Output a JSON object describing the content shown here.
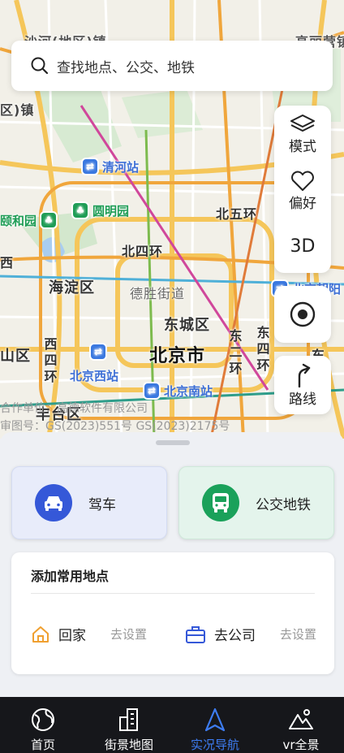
{
  "search": {
    "placeholder": "查找地点、公交、地铁",
    "icon": "search-icon"
  },
  "map": {
    "labels": {
      "qinghe": "清河站",
      "yuanmingyuan": "圆明园",
      "yiheyuan": "颐和园",
      "beiwuhuan": "北五环",
      "beisihuan": "北四环",
      "haidian": "海淀区",
      "deshengjie": "德胜街道",
      "chaoyang": "北京朝阳",
      "dongcheng": "东城区",
      "beijingshi": "北京市",
      "shanqu": "山区",
      "xisihuan": "西四环",
      "dongerhuan": "东二环",
      "dongsihuan": "东四环",
      "beijingxi": "北京西站",
      "beijingnan": "北京南站",
      "fengtai": "丰台区",
      "dong_fragment": "东",
      "qu_zhen": "区)镇",
      "xi_fragment": "西",
      "top_left": "沙河(地区)镇",
      "top_right": "高丽营镇"
    },
    "copyright_1": "合作单位：高德软件有限公司",
    "copyright_2": "审图号：GS(2023)551号  GS(2023)2175号"
  },
  "tools": {
    "mode_label": "模式",
    "favorite_label": "偏好",
    "threed_label": "3D",
    "route_label": "路线"
  },
  "modes": {
    "drive_label": "驾车",
    "transit_label": "公交地铁"
  },
  "places": {
    "title": "添加常用地点",
    "home_label": "回家",
    "home_action": "去设置",
    "work_label": "去公司",
    "work_action": "去设置"
  },
  "tabs": [
    {
      "label": "首页",
      "icon": "globe-icon"
    },
    {
      "label": "街景地图",
      "icon": "buildings-icon"
    },
    {
      "label": "实况导航",
      "icon": "navigation-arrow-icon"
    },
    {
      "label": "vr全景",
      "icon": "mountain-icon"
    }
  ],
  "colors": {
    "accent": "#3d7cf2",
    "drive": "#3558d8",
    "transit": "#1aa15a",
    "home_icon": "#f0a030",
    "work_icon": "#3558d8"
  }
}
